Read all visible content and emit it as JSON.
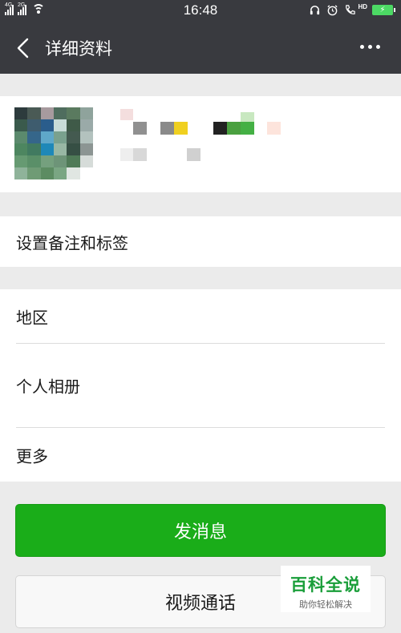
{
  "status_bar": {
    "network_1": "4G",
    "network_2": "2G",
    "time": "16:48",
    "hd_label": "HD"
  },
  "header": {
    "title": "详细资料",
    "back_icon": "chevron-left-icon",
    "more_icon": "more-dots-icon"
  },
  "profile": {
    "avatar": "avatar-image (pixelated)",
    "name": "",
    "details": ""
  },
  "menu": {
    "remark_tags": "设置备注和标签",
    "region": "地区",
    "album": "个人相册",
    "more": "更多"
  },
  "actions": {
    "send_message": "发消息",
    "video_call": "视频通话"
  },
  "watermark": {
    "title": "百科全说",
    "subtitle": "助你轻松解决"
  },
  "colors": {
    "header_bg": "#393a3f",
    "primary_green": "#1aad19",
    "page_bg": "#ebebeb"
  }
}
